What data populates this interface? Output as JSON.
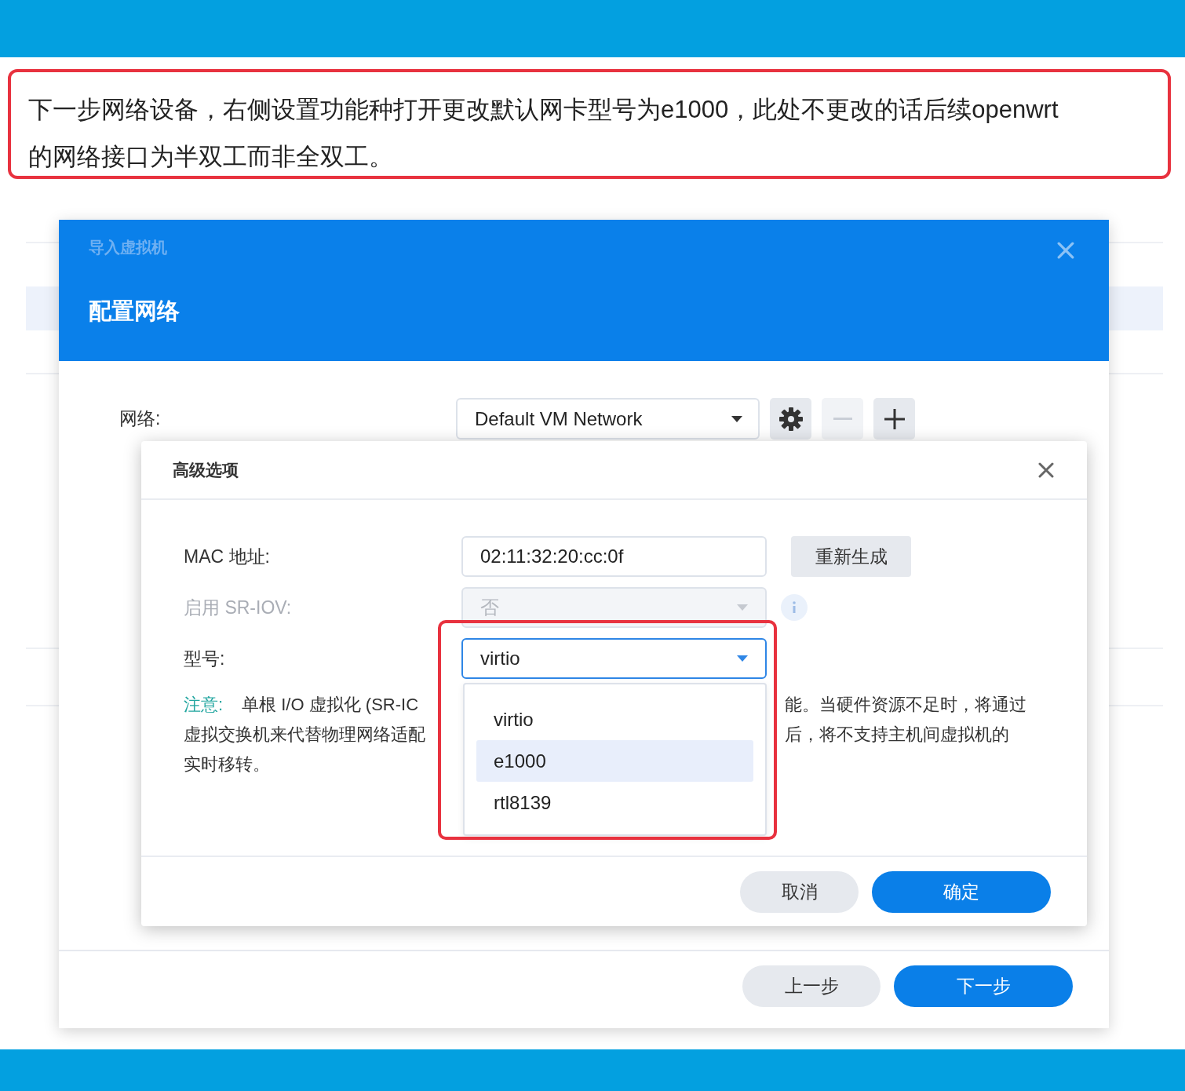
{
  "caption": {
    "text": "下一步网络设备，右侧设置功能种打开更改默认网卡型号为e1000，此处不更改的话后续openwrt的网络接口为半双工而非全双工。"
  },
  "dialog": {
    "subtitle": "导入虚拟机",
    "title": "配置网络",
    "network_label": "网络:",
    "network_value": "Default VM Network",
    "tools": [
      {
        "kind": "gear",
        "disabled": false
      },
      {
        "kind": "minus",
        "disabled": true
      },
      {
        "kind": "plus",
        "disabled": false
      }
    ],
    "buttons": [
      {
        "label": "上一步",
        "kind": "secondary"
      },
      {
        "label": "下一步",
        "kind": "primary"
      }
    ]
  },
  "advanced": {
    "title": "高级选项",
    "fields": [
      {
        "label": "MAC 地址:",
        "value": "02:11:32:20:cc:0f",
        "kind": "text",
        "disabled": false,
        "focused": false
      },
      {
        "label": "启用 SR-IOV:",
        "value": "否",
        "kind": "select",
        "disabled": true,
        "focused": false
      },
      {
        "label": "型号:",
        "value": "virtio",
        "kind": "select",
        "disabled": false,
        "focused": true
      }
    ],
    "regenerate": "重新生成",
    "note_label": "注意:",
    "note_lines": [
      {
        "left": "单根 I/O 虚拟化 (SR-IC",
        "right": "能。当硬件资源不足时，将通过"
      },
      {
        "left": "虚拟交换机来代替物理网络适配",
        "right": "后，将不支持主机间虚拟机的"
      },
      {
        "left": "实时移转。"
      }
    ],
    "options": [
      {
        "label": "virtio",
        "highlighted": false
      },
      {
        "label": "e1000",
        "highlighted": true
      },
      {
        "label": "rtl8139",
        "highlighted": false
      }
    ],
    "buttons": [
      {
        "label": "取消",
        "kind": "secondary"
      },
      {
        "label": "确定",
        "kind": "primary"
      }
    ]
  }
}
